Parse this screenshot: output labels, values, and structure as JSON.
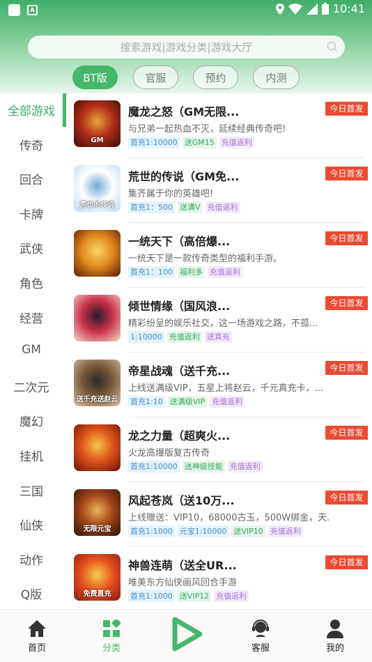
{
  "statusbar": {
    "time": "10:41"
  },
  "search": {
    "placeholder": "搜索游戏|游戏分类|游戏大厅"
  },
  "tabs": [
    "BT版",
    "官服",
    "预约",
    "内测"
  ],
  "categories": [
    "全部游戏",
    "传奇",
    "回合",
    "卡牌",
    "武侠",
    "角色",
    "经营",
    "GM",
    "二次元",
    "魔幻",
    "挂机",
    "三国",
    "仙侠",
    "动作",
    "Q版"
  ],
  "badge_label": "今日首发",
  "games": [
    {
      "title": "魔龙之怒（GM无限...",
      "desc": "与兄弟一起热血不灭，延续经典传奇吧!",
      "tags": [
        {
          "t": "首充1:10000",
          "c": "blue"
        },
        {
          "t": "送GM15",
          "c": "green"
        },
        {
          "t": "充值返利",
          "c": "purple"
        }
      ],
      "thumb_text": "GM",
      "colors": [
        "#3a0a04",
        "#b2301a",
        "#e8a33a"
      ]
    },
    {
      "title": "荒世的传说（GM免...",
      "desc": "集齐属于你的英雄吧!",
      "tags": [
        {
          "t": "首充1：500",
          "c": "blue"
        },
        {
          "t": "送满V",
          "c": "green"
        },
        {
          "t": "充值返利",
          "c": "purple"
        }
      ],
      "thumb_text": "荒世的传说",
      "colors": [
        "#b8dbf0",
        "#ffffff",
        "#6fa9d8"
      ]
    },
    {
      "title": " 一统天下（高倍爆...",
      "desc": "一统天下是一款传奇类型的福利手游。",
      "tags": [
        {
          "t": "首充1：100",
          "c": "blue"
        },
        {
          "t": "福利多",
          "c": "green"
        },
        {
          "t": "充值返利",
          "c": "purple"
        }
      ],
      "thumb_text": "",
      "colors": [
        "#5a1a08",
        "#e28b1c",
        "#f7d36a"
      ]
    },
    {
      "title": "倾世情缘（国风浪...",
      "desc": "精彩纷呈的娱乐社交，这一场游戏之路，不孤...",
      "tags": [
        {
          "t": "1:10000",
          "c": "blue"
        },
        {
          "t": "充值返利",
          "c": "green"
        },
        {
          "t": "送真充",
          "c": "purple"
        }
      ],
      "thumb_text": "",
      "colors": [
        "#f4d9c8",
        "#c7304a",
        "#2b1a2a"
      ]
    },
    {
      "title": "帝星战魂（送千充...",
      "desc": "上线送满级VIP，五星上将赵云，千元真充卡，...",
      "tags": [
        {
          "t": "首充1:10",
          "c": "blue"
        },
        {
          "t": "送满级VIP",
          "c": "green"
        },
        {
          "t": "充值返利",
          "c": "purple"
        }
      ],
      "thumb_text": "送千充送赵云",
      "colors": [
        "#d9c3a3",
        "#7a5a3a",
        "#2a2a2a"
      ]
    },
    {
      "title": "龙之力量（超爽火...",
      "desc": "火龙高爆版复古传奇",
      "tags": [
        {
          "t": "首充1:10000",
          "c": "blue"
        },
        {
          "t": "送神级技能",
          "c": "green"
        },
        {
          "t": "充值返利",
          "c": "purple"
        }
      ],
      "thumb_text": "",
      "colors": [
        "#6a0f05",
        "#e0551c",
        "#f5c44a"
      ]
    },
    {
      "title": "风起苍岚（送10万...",
      "desc": "上线赠送：VIP10，68000古玉，500W绑金，天...",
      "tags": [
        {
          "t": "首充1:1000",
          "c": "blue"
        },
        {
          "t": "元宝1:10000",
          "c": "blue"
        },
        {
          "t": "送VIP10",
          "c": "green"
        },
        {
          "t": "充值返利",
          "c": "purple"
        }
      ],
      "thumb_text": "无限元宝",
      "colors": [
        "#2a1408",
        "#a44618",
        "#e8b25a"
      ]
    },
    {
      "title": "神兽连萌（送全UR...",
      "desc": "唯美东方仙侠画风回合手游",
      "tags": [
        {
          "t": "首充1:1000",
          "c": "blue"
        },
        {
          "t": "送VIP12",
          "c": "green"
        },
        {
          "t": "充值返利",
          "c": "purple"
        }
      ],
      "thumb_text": "免费直充",
      "colors": [
        "#8a1a10",
        "#e7531f",
        "#f5d04a"
      ]
    }
  ],
  "nav": [
    {
      "label": "首页",
      "icon": "home-icon"
    },
    {
      "label": "分类",
      "icon": "category-icon"
    },
    {
      "label": "",
      "icon": "play-icon"
    },
    {
      "label": "客服",
      "icon": "customer-service-icon"
    },
    {
      "label": "我的",
      "icon": "profile-icon"
    }
  ]
}
